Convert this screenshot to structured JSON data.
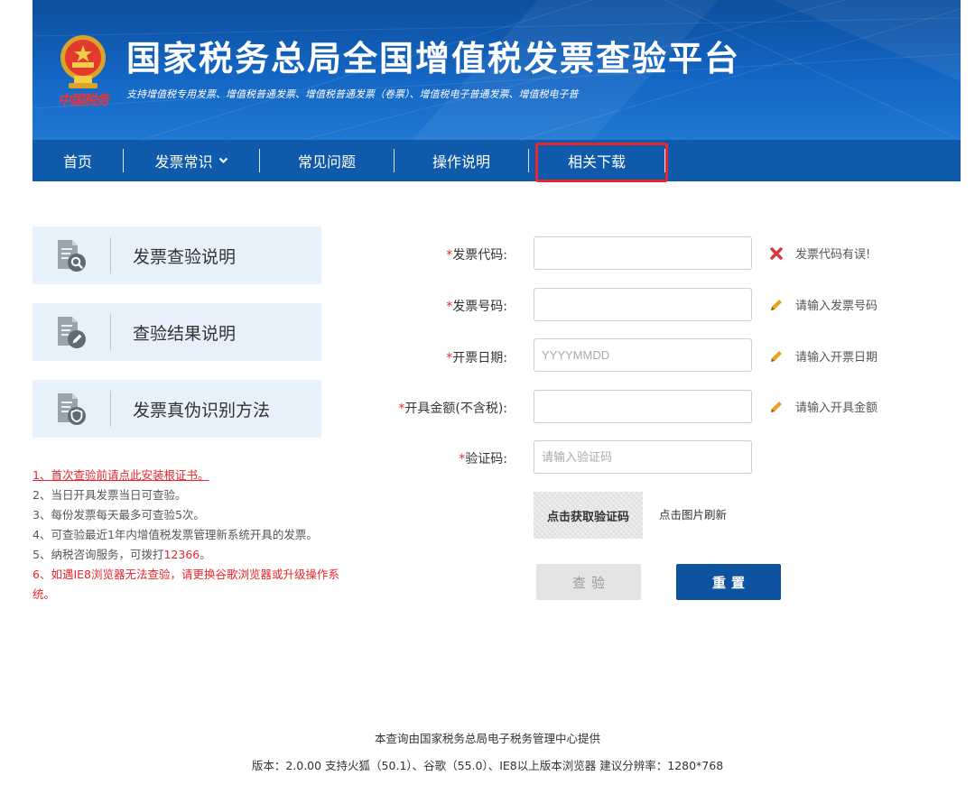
{
  "header": {
    "title": "国家税务总局全国增值税发票查验平台",
    "subtitle": "支持增值税专用发票、增值税普通发票、增值税普通发票（卷票）、增值税电子普通发票、增值税电子普",
    "brand_text": "中国税务",
    "emblem_icon": "national-emblem-icon"
  },
  "nav": {
    "items": [
      {
        "label": "首页"
      },
      {
        "label": "发票常识",
        "dropdown": true
      },
      {
        "label": "常见问题"
      },
      {
        "label": "操作说明"
      },
      {
        "label": "相关下载",
        "highlighted": true
      }
    ],
    "highlight_color": "#e8262b"
  },
  "sidebar": {
    "cards": [
      {
        "label": "发票查验说明",
        "icon": "document-search-icon"
      },
      {
        "label": "查验结果说明",
        "icon": "document-edit-icon"
      },
      {
        "label": "发票真伪识别方法",
        "icon": "document-shield-icon"
      }
    ],
    "notes": [
      {
        "text": "1、首次查验前请点此安装根证书。",
        "style": "red-link"
      },
      {
        "text": "2、当日开具发票当日可查验。",
        "style": "normal"
      },
      {
        "text": "3、每份发票每天最多可查验5次。",
        "style": "normal"
      },
      {
        "text": "4、可查验最近1年内增值税发票管理新系统开具的发票。",
        "style": "normal"
      },
      {
        "text_prefix": "5、纳税咨询服务，可拨打",
        "phone": "12366",
        "text_suffix": "。",
        "style": "normal"
      },
      {
        "text": "6、如遇IE8浏览器无法查验，请更换谷歌浏览器或升级操作系统。",
        "style": "red"
      }
    ]
  },
  "form": {
    "required_mark": "*",
    "fields": [
      {
        "label": "发票代码:",
        "value": "",
        "placeholder": "",
        "hint": "发票代码有误!",
        "hint_icon": "error-x-icon"
      },
      {
        "label": "发票号码:",
        "value": "",
        "placeholder": "",
        "hint": "请输入发票号码",
        "hint_icon": "pencil-icon"
      },
      {
        "label": "开票日期:",
        "value": "",
        "placeholder": "YYYYMMDD",
        "hint": "请输入开票日期",
        "hint_icon": "pencil-icon"
      },
      {
        "label": "开具金额(不含税):",
        "value": "",
        "placeholder": "",
        "hint": "请输入开具金额",
        "hint_icon": "pencil-icon"
      },
      {
        "label": "验证码:",
        "value": "",
        "placeholder": "请输入验证码"
      }
    ],
    "captcha_text": "点击获取验证码",
    "captcha_refresh": "点击图片刷新",
    "check_button": "查验",
    "reset_button": "重置"
  },
  "footer": {
    "line1": "本查询由国家税务总局电子税务管理中心提供",
    "line2": "版本：2.0.00   支持火狐（50.1）、谷歌（55.0）、IE8以上版本浏览器   建议分辨率：1280*768"
  },
  "colors": {
    "header_blue": "#1466c4",
    "nav_blue": "#0f5aaa",
    "card_bg": "#e6f1fc",
    "accent_red": "#e8262b",
    "reset_button": "#0e539f",
    "hint_pencil": "#f0a020"
  }
}
